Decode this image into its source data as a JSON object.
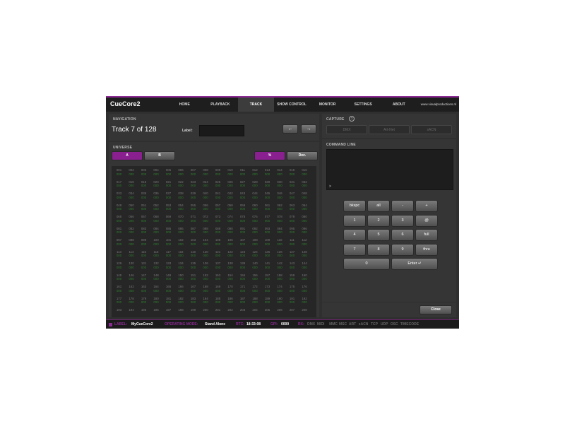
{
  "header": {
    "brand": "CueCore2",
    "tabs": [
      "HOME",
      "PLAYBACK",
      "TRACK",
      "SHOW CONTROL",
      "MONITOR",
      "SETTINGS",
      "ABOUT"
    ],
    "active_tab": "TRACK",
    "website": "www.visualproductions.nl"
  },
  "navigation": {
    "title": "NAVIGATION",
    "track": "Track 7 of 128",
    "label_text": "Label:",
    "label_value": "",
    "prev": "←",
    "next": "→"
  },
  "capture": {
    "title": "CAPTURE",
    "help_icon": "?",
    "buttons": [
      "DMX",
      "Art-Net",
      "sACN"
    ]
  },
  "universe": {
    "title": "UNIVERSE",
    "buttons": [
      "A",
      "B"
    ],
    "format_buttons": [
      "%",
      "Dec."
    ],
    "rows": [
      {
        "ch": [
          "001",
          "002",
          "003",
          "004",
          "005",
          "006",
          "007",
          "008",
          "009",
          "010",
          "011",
          "012",
          "013",
          "014",
          "015",
          "016"
        ],
        "val": [
          "000",
          "000",
          "000",
          "000",
          "000",
          "000",
          "000",
          "000",
          "000",
          "000",
          "000",
          "000",
          "000",
          "000",
          "000",
          "000"
        ]
      },
      {
        "ch": [
          "017",
          "018",
          "019",
          "020",
          "021",
          "022",
          "023",
          "024",
          "025",
          "026",
          "027",
          "028",
          "029",
          "030",
          "031",
          "032"
        ],
        "val": [
          "000",
          "000",
          "000",
          "000",
          "000",
          "000",
          "000",
          "000",
          "000",
          "000",
          "000",
          "000",
          "000",
          "000",
          "000",
          "000"
        ]
      },
      {
        "ch": [
          "033",
          "034",
          "035",
          "036",
          "037",
          "038",
          "039",
          "040",
          "041",
          "042",
          "043",
          "044",
          "045",
          "046",
          "047",
          "048"
        ],
        "val": [
          "000",
          "000",
          "000",
          "000",
          "000",
          "000",
          "000",
          "000",
          "000",
          "000",
          "000",
          "000",
          "000",
          "000",
          "000",
          "000"
        ]
      },
      {
        "ch": [
          "049",
          "050",
          "051",
          "052",
          "053",
          "054",
          "055",
          "056",
          "057",
          "058",
          "059",
          "060",
          "061",
          "062",
          "063",
          "064"
        ],
        "val": [
          "000",
          "000",
          "000",
          "000",
          "000",
          "000",
          "000",
          "000",
          "000",
          "000",
          "000",
          "000",
          "000",
          "000",
          "000",
          "000"
        ]
      },
      {
        "ch": [
          "065",
          "066",
          "067",
          "068",
          "069",
          "070",
          "071",
          "072",
          "073",
          "074",
          "075",
          "076",
          "077",
          "078",
          "079",
          "080"
        ],
        "val": [
          "000",
          "000",
          "000",
          "000",
          "000",
          "000",
          "000",
          "000",
          "000",
          "000",
          "000",
          "000",
          "000",
          "000",
          "000",
          "000"
        ]
      },
      {
        "ch": [
          "081",
          "082",
          "083",
          "084",
          "085",
          "086",
          "087",
          "088",
          "089",
          "090",
          "091",
          "092",
          "093",
          "094",
          "095",
          "096"
        ],
        "val": [
          "000",
          "000",
          "000",
          "000",
          "000",
          "000",
          "000",
          "000",
          "000",
          "000",
          "000",
          "000",
          "000",
          "000",
          "000",
          "000"
        ]
      },
      {
        "ch": [
          "097",
          "098",
          "099",
          "100",
          "101",
          "102",
          "103",
          "104",
          "105",
          "106",
          "107",
          "108",
          "109",
          "110",
          "111",
          "112"
        ],
        "val": [
          "000",
          "000",
          "000",
          "000",
          "000",
          "000",
          "000",
          "000",
          "000",
          "000",
          "000",
          "000",
          "000",
          "000",
          "000",
          "000"
        ]
      },
      {
        "ch": [
          "113",
          "114",
          "115",
          "116",
          "117",
          "118",
          "119",
          "120",
          "121",
          "122",
          "123",
          "124",
          "125",
          "126",
          "127",
          "128"
        ],
        "val": [
          "000",
          "000",
          "000",
          "000",
          "000",
          "000",
          "000",
          "000",
          "000",
          "000",
          "000",
          "000",
          "000",
          "000",
          "000",
          "000"
        ]
      },
      {
        "ch": [
          "129",
          "130",
          "131",
          "132",
          "133",
          "134",
          "135",
          "136",
          "137",
          "138",
          "139",
          "140",
          "141",
          "142",
          "143",
          "144"
        ],
        "val": [
          "000",
          "000",
          "000",
          "000",
          "000",
          "000",
          "000",
          "000",
          "000",
          "000",
          "000",
          "000",
          "000",
          "000",
          "000",
          "000"
        ]
      },
      {
        "ch": [
          "145",
          "146",
          "147",
          "148",
          "149",
          "150",
          "151",
          "152",
          "153",
          "154",
          "155",
          "156",
          "157",
          "158",
          "159",
          "160"
        ],
        "val": [
          "000",
          "000",
          "000",
          "000",
          "000",
          "000",
          "000",
          "000",
          "000",
          "000",
          "000",
          "000",
          "000",
          "000",
          "000",
          "000"
        ]
      },
      {
        "ch": [
          "161",
          "162",
          "163",
          "164",
          "165",
          "166",
          "167",
          "168",
          "169",
          "170",
          "171",
          "172",
          "173",
          "174",
          "175",
          "176"
        ],
        "val": [
          "000",
          "000",
          "000",
          "000",
          "000",
          "000",
          "000",
          "000",
          "000",
          "000",
          "000",
          "000",
          "000",
          "000",
          "000",
          "000"
        ]
      },
      {
        "ch": [
          "177",
          "178",
          "179",
          "180",
          "181",
          "182",
          "183",
          "184",
          "185",
          "186",
          "187",
          "188",
          "189",
          "190",
          "191",
          "192"
        ],
        "val": [
          "000",
          "000",
          "000",
          "000",
          "000",
          "000",
          "000",
          "000",
          "000",
          "000",
          "000",
          "000",
          "000",
          "000",
          "000",
          "000"
        ]
      },
      {
        "ch": [
          "193",
          "194",
          "195",
          "196",
          "197",
          "198",
          "199",
          "200",
          "201",
          "202",
          "203",
          "204",
          "205",
          "206",
          "207",
          "208"
        ],
        "val": []
      }
    ]
  },
  "command_line": {
    "title": "COMMAND LINE",
    "prompt": ">",
    "keys": [
      [
        "bkspc",
        "all",
        "-",
        "+"
      ],
      [
        "1",
        "2",
        "3",
        "@"
      ],
      [
        "4",
        "5",
        "6",
        "full"
      ],
      [
        "7",
        "8",
        "9",
        "thru"
      ]
    ],
    "zero": "0",
    "enter": "Enter ↵"
  },
  "close_label": "Close",
  "status": {
    "label_key": "LABEL:",
    "label_val": "MyCueCore2",
    "mode_key": "OPERATING MODE:",
    "mode_val": "Stand Alone",
    "rtc_key": "RTC:",
    "rtc_val": "18:33:08",
    "gpi_key": "GPI:",
    "gpi_val": "0000",
    "rx_key": "RX:",
    "rx_items": [
      "DMX",
      "MIDI",
      "MMC",
      "MSC",
      "ART",
      "sACN",
      "TCP",
      "UDP",
      "OSC",
      "TIMECODE"
    ]
  },
  "colors": {
    "accent": "#8b2a92",
    "value_green": "#2f7a2f",
    "background": "#2f2f2f"
  }
}
